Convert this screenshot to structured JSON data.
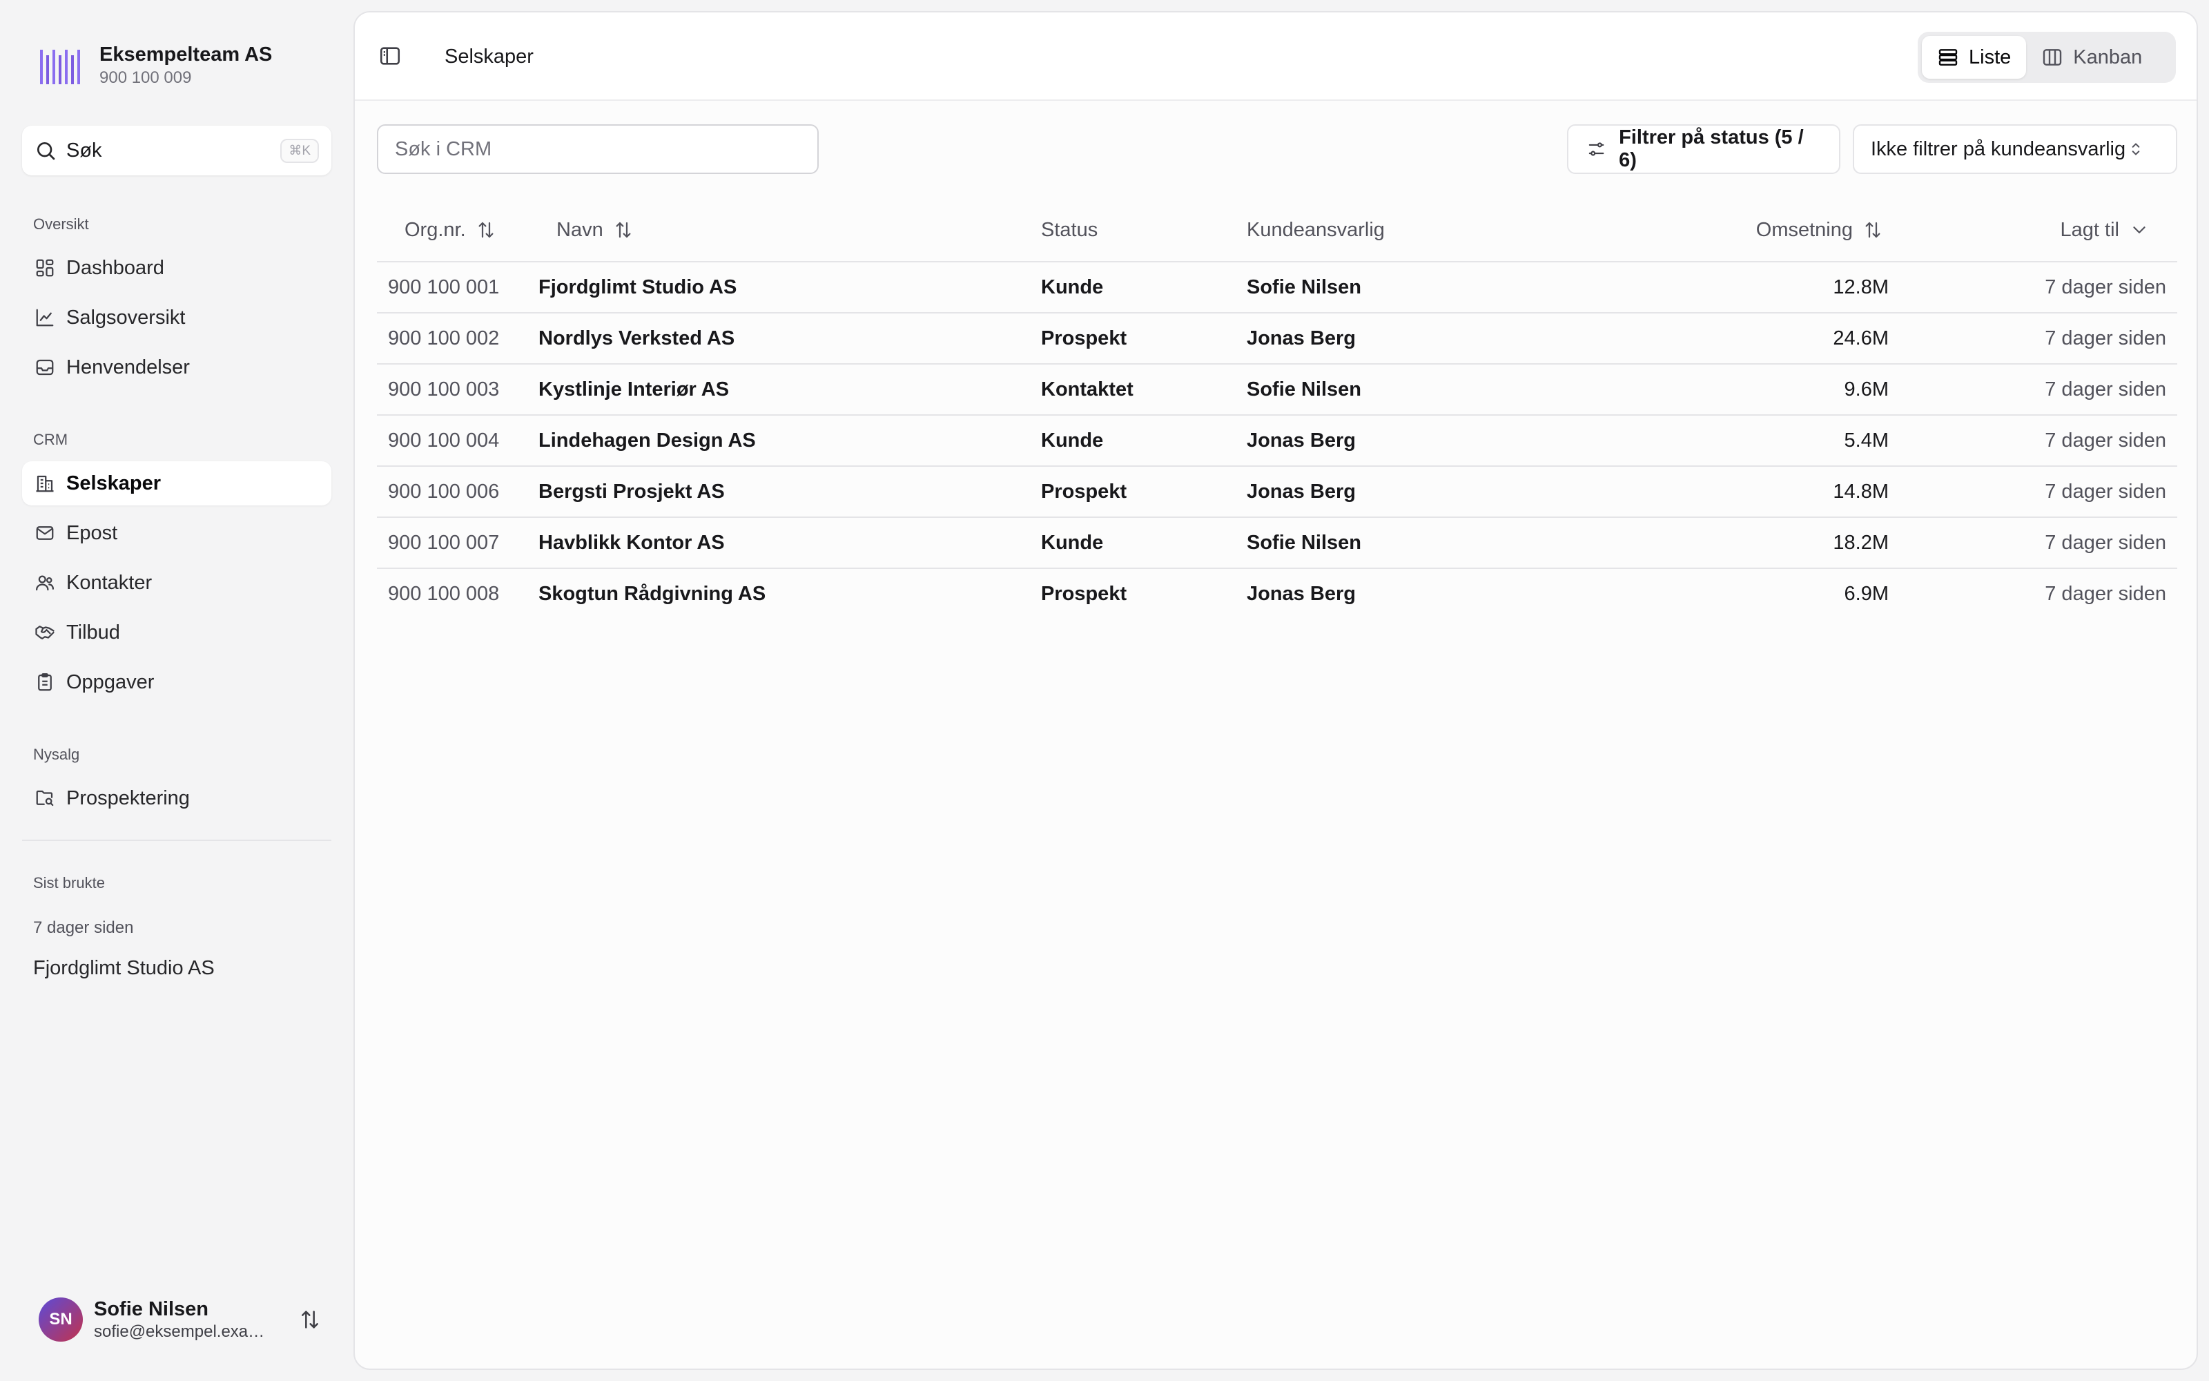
{
  "team": {
    "name": "Eksempelteam AS",
    "orgnr": "900 100 009"
  },
  "search": {
    "label": "Søk",
    "shortcut": "⌘K"
  },
  "sidebar": {
    "sections": [
      {
        "label": "Oversikt",
        "items": [
          {
            "label": "Dashboard",
            "icon": "dashboard-icon"
          },
          {
            "label": "Salgsoversikt",
            "icon": "chart-line-icon"
          },
          {
            "label": "Henvendelser",
            "icon": "inbox-icon"
          }
        ]
      },
      {
        "label": "CRM",
        "items": [
          {
            "label": "Selskaper",
            "icon": "building-icon",
            "active": true
          },
          {
            "label": "Epost",
            "icon": "mail-icon"
          },
          {
            "label": "Kontakter",
            "icon": "users-icon"
          },
          {
            "label": "Tilbud",
            "icon": "handshake-icon"
          },
          {
            "label": "Oppgaver",
            "icon": "clipboard-icon"
          }
        ]
      },
      {
        "label": "Nysalg",
        "items": [
          {
            "label": "Prospektering",
            "icon": "folder-search-icon"
          }
        ]
      }
    ],
    "recent": {
      "label": "Sist brukte",
      "time": "7 dager siden",
      "items": [
        "Fjordglimt Studio AS"
      ]
    }
  },
  "user": {
    "initials": "SN",
    "name": "Sofie Nilsen",
    "email": "sofie@eksempel.example"
  },
  "header": {
    "title": "Selskaper",
    "views": [
      {
        "label": "Liste",
        "icon": "list-icon",
        "active": true
      },
      {
        "label": "Kanban",
        "icon": "kanban-icon",
        "active": false
      }
    ]
  },
  "filters": {
    "search_placeholder": "Søk i CRM",
    "status_label": "Filtrer på status (5 / 6)",
    "owner_label": "Ikke filtrer på kundeansvarlig"
  },
  "table": {
    "columns": [
      "Org.nr.",
      "Navn",
      "Status",
      "Kundeansvarlig",
      "Omsetning",
      "Lagt til"
    ],
    "rows": [
      {
        "orgnr": "900 100 001",
        "name": "Fjordglimt Studio AS",
        "status": "Kunde",
        "owner": "Sofie Nilsen",
        "revenue": "12.8M",
        "added": "7 dager siden"
      },
      {
        "orgnr": "900 100 002",
        "name": "Nordlys Verksted AS",
        "status": "Prospekt",
        "owner": "Jonas Berg",
        "revenue": "24.6M",
        "added": "7 dager siden"
      },
      {
        "orgnr": "900 100 003",
        "name": "Kystlinje Interiør AS",
        "status": "Kontaktet",
        "owner": "Sofie Nilsen",
        "revenue": "9.6M",
        "added": "7 dager siden"
      },
      {
        "orgnr": "900 100 004",
        "name": "Lindehagen Design AS",
        "status": "Kunde",
        "owner": "Jonas Berg",
        "revenue": "5.4M",
        "added": "7 dager siden"
      },
      {
        "orgnr": "900 100 006",
        "name": "Bergsti Prosjekt AS",
        "status": "Prospekt",
        "owner": "Jonas Berg",
        "revenue": "14.8M",
        "added": "7 dager siden"
      },
      {
        "orgnr": "900 100 007",
        "name": "Havblikk Kontor AS",
        "status": "Kunde",
        "owner": "Sofie Nilsen",
        "revenue": "18.2M",
        "added": "7 dager siden"
      },
      {
        "orgnr": "900 100 008",
        "name": "Skogtun Rådgivning AS",
        "status": "Prospekt",
        "owner": "Jonas Berg",
        "revenue": "6.9M",
        "added": "7 dager siden"
      }
    ]
  },
  "colors": {
    "brand": "#7c5ce0",
    "panel": "#fcfcfc",
    "sidebar_bg": "#f4f4f5"
  }
}
